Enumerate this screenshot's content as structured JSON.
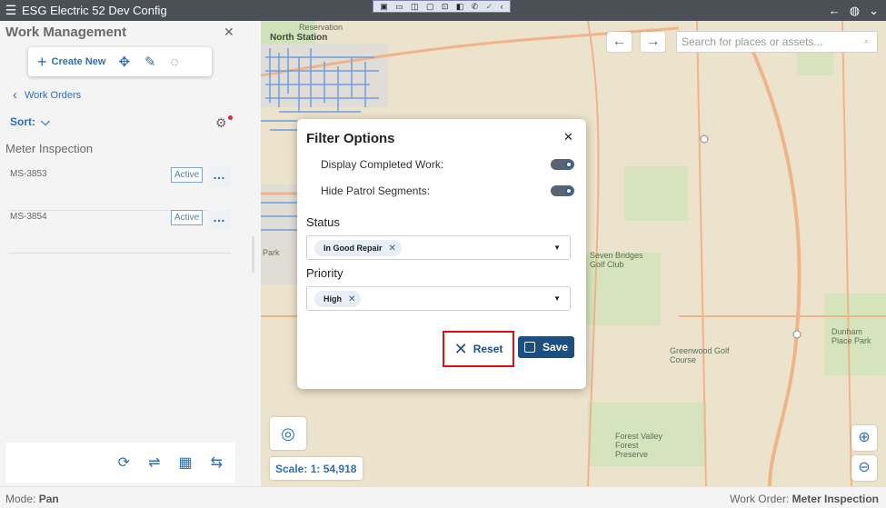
{
  "titlebar": {
    "menu_icon": "hamburger-icon",
    "title": "ESG Electric 52 Dev Config",
    "right_icons": [
      "back-arrow-icon",
      "globe-icon",
      "chevron-down-icon"
    ]
  },
  "left_panel": {
    "title": "Work Management",
    "toolbar": {
      "create_label": "Create New",
      "icons": [
        "move-icon",
        "edit-icon",
        "lasso-icon"
      ]
    },
    "breadcrumb": "Work Orders",
    "sort_label": "Sort:",
    "section_title": "Meter Inspection",
    "work_orders": [
      {
        "id": "MS-3853",
        "status": "Active"
      },
      {
        "id": "MS-3854",
        "status": "Active"
      }
    ],
    "bottom_tools": [
      "refresh-icon",
      "route-icon",
      "calendar-icon",
      "transfer-icon"
    ]
  },
  "map": {
    "search_placeholder": "Search for places or assets...",
    "labels": {
      "north_station": "North Station",
      "reservation": "Reservation",
      "seven_bridges": "Seven Bridges Golf Club",
      "greenwood": "Greenwood Golf Course",
      "forest_valley": "Forest Valley Forest Preserve",
      "dunham": "Dunham Place Park",
      "park": "Park"
    },
    "scale_label": "Scale:",
    "scale_value": "1: 54,918"
  },
  "filter_modal": {
    "title": "Filter Options",
    "toggles": [
      {
        "label": "Display Completed Work:",
        "on": true
      },
      {
        "label": "Hide Patrol Segments:",
        "on": true
      }
    ],
    "status_label": "Status",
    "status_chip": "In Good Repair",
    "priority_label": "Priority",
    "priority_chip": "High",
    "reset_label": "Reset",
    "save_label": "Save"
  },
  "statusbar": {
    "mode_label": "Mode:",
    "mode_value": "Pan",
    "work_order_label": "Work Order:",
    "work_order_value": "Meter Inspection"
  },
  "colors": {
    "accent": "#2f6fb3",
    "save_button": "#1c4f7f",
    "highlight_border": "#dd1111",
    "map_base": "#ece3cd",
    "road_orange": "#f0b48a",
    "road_blue": "#6d9fe0"
  }
}
